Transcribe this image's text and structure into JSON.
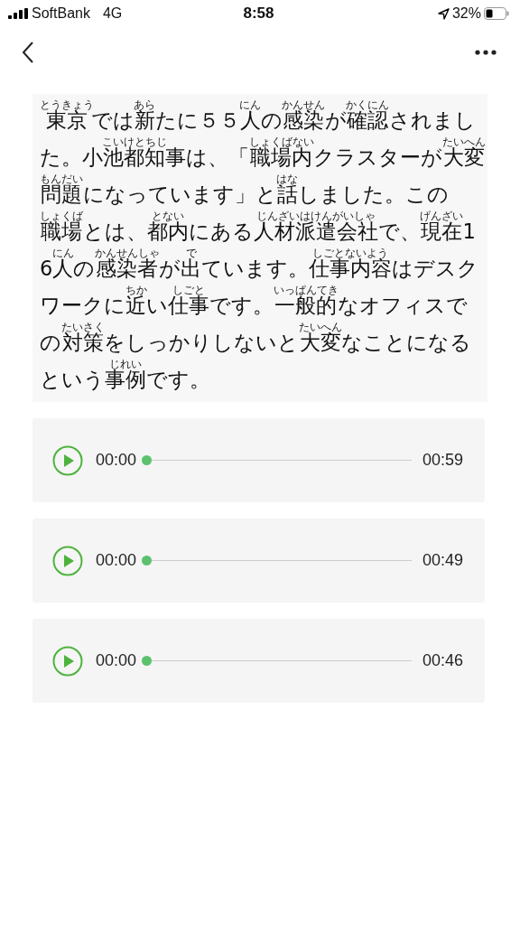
{
  "status_bar": {
    "carrier": "SoftBank",
    "network": "4G",
    "time": "8:58",
    "battery": "32%"
  },
  "article": [
    {
      "text": "東京",
      "ruby": "とうきょう"
    },
    {
      "text": "では"
    },
    {
      "text": "新",
      "ruby": "あら"
    },
    {
      "text": "たに５５"
    },
    {
      "text": "人",
      "ruby": "にん"
    },
    {
      "text": "の"
    },
    {
      "text": "感染",
      "ruby": "かんせん"
    },
    {
      "text": "が"
    },
    {
      "text": "確認",
      "ruby": "かくにん"
    },
    {
      "text": "されました。"
    },
    {
      "text": "小池都知事",
      "ruby": "こいけとちじ"
    },
    {
      "text": "は、「"
    },
    {
      "text": "職場内",
      "ruby": "しょくばない"
    },
    {
      "text": "クラスターが"
    },
    {
      "text": "大変",
      "ruby": "たいへん"
    },
    {
      "text": "問題",
      "ruby": "もんだい"
    },
    {
      "text": "になっています」と"
    },
    {
      "text": "話",
      "ruby": "はな"
    },
    {
      "text": "しました。この"
    },
    {
      "text": "職場",
      "ruby": "しょくば"
    },
    {
      "text": "とは、"
    },
    {
      "text": "都内",
      "ruby": "とない"
    },
    {
      "text": "にある"
    },
    {
      "text": "人材派遣会社",
      "ruby": "じんざいはけんがいしゃ"
    },
    {
      "text": "で、"
    },
    {
      "text": "現在",
      "ruby": "げんざい"
    },
    {
      "text": "16"
    },
    {
      "text": "人",
      "ruby": "にん"
    },
    {
      "text": "の"
    },
    {
      "text": "感染者",
      "ruby": "かんせんしゃ"
    },
    {
      "text": "が"
    },
    {
      "text": "出",
      "ruby": "で"
    },
    {
      "text": "ています。"
    },
    {
      "text": "仕事内容",
      "ruby": "しごとないよう"
    },
    {
      "text": "はデスクワークに"
    },
    {
      "text": "近",
      "ruby": "ちか"
    },
    {
      "text": "い"
    },
    {
      "text": "仕事",
      "ruby": "しごと"
    },
    {
      "text": "です。"
    },
    {
      "text": "一般的",
      "ruby": "いっぱんてき"
    },
    {
      "text": "なオフィスでの"
    },
    {
      "text": "対策",
      "ruby": "たいさく"
    },
    {
      "text": "をしっかりしないと"
    },
    {
      "text": "大変",
      "ruby": "たいへん"
    },
    {
      "text": "なことになるという"
    },
    {
      "text": "事例",
      "ruby": "じれい"
    },
    {
      "text": "です。"
    }
  ],
  "players": [
    {
      "current": "00:00",
      "duration": "00:59",
      "level": 0
    },
    {
      "current": "00:00",
      "duration": "00:49",
      "level": 0
    },
    {
      "current": "00:00",
      "duration": "00:46",
      "level": 0
    }
  ]
}
